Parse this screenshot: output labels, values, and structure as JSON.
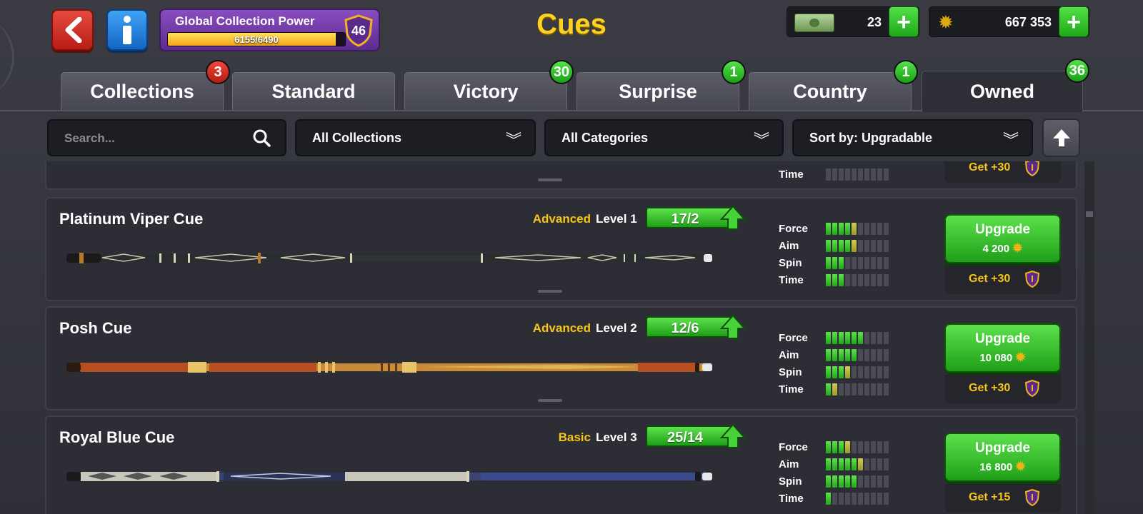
{
  "header": {
    "title": "Cues",
    "global_collection_power": {
      "label": "Global Collection Power",
      "current": 6155,
      "max": 6490,
      "text": "6155/6490",
      "level": "46"
    },
    "cash": {
      "amount": "23",
      "icon": "cash-icon"
    },
    "coins": {
      "amount": "667 353",
      "icon": "coin-gear-icon"
    }
  },
  "tabs": [
    {
      "label": "Collections",
      "badge": "3",
      "badge_color": "#d32a1f"
    },
    {
      "label": "Standard",
      "badge": null
    },
    {
      "label": "Victory",
      "badge": "30",
      "badge_color": "#2fbf22"
    },
    {
      "label": "Surprise",
      "badge": "1",
      "badge_color": "#2fbf22"
    },
    {
      "label": "Country",
      "badge": "1",
      "badge_color": "#2fbf22"
    },
    {
      "label": "Owned",
      "badge": "36",
      "badge_color": "#2fbf22",
      "active": true
    }
  ],
  "filters": {
    "search_placeholder": "Search...",
    "collections": "All Collections",
    "categories": "All Categories",
    "sort": "Sort by: Upgradable"
  },
  "partial_card": {
    "stat_label": "Time",
    "get_text": "Get +30"
  },
  "cues": [
    {
      "name": "Platinum Viper Cue",
      "tier": "Advanced",
      "level": "Level 1",
      "progress": "17/2",
      "stats": [
        {
          "label": "Force",
          "green": 4,
          "yellow": 1
        },
        {
          "label": "Aim",
          "green": 4,
          "yellow": 1
        },
        {
          "label": "Spin",
          "green": 3,
          "yellow": 0
        },
        {
          "label": "Time",
          "green": 3,
          "yellow": 0
        }
      ],
      "upgrade_label": "Upgrade",
      "upgrade_cost": "4 200",
      "get_text": "Get +30"
    },
    {
      "name": "Posh Cue",
      "tier": "Advanced",
      "level": "Level 2",
      "progress": "12/6",
      "stats": [
        {
          "label": "Force",
          "green": 6,
          "yellow": 0
        },
        {
          "label": "Aim",
          "green": 5,
          "yellow": 0
        },
        {
          "label": "Spin",
          "green": 3,
          "yellow": 1
        },
        {
          "label": "Time",
          "green": 1,
          "yellow": 1
        }
      ],
      "upgrade_label": "Upgrade",
      "upgrade_cost": "10 080",
      "get_text": "Get +30"
    },
    {
      "name": "Royal Blue Cue",
      "tier": "Basic",
      "level": "Level 3",
      "progress": "25/14",
      "stats": [
        {
          "label": "Force",
          "green": 3,
          "yellow": 1
        },
        {
          "label": "Aim",
          "green": 5,
          "yellow": 1
        },
        {
          "label": "Spin",
          "green": 5,
          "yellow": 0
        },
        {
          "label": "Time",
          "green": 1,
          "yellow": 0
        }
      ],
      "upgrade_label": "Upgrade",
      "upgrade_cost": "16 800",
      "get_text": "Get +15"
    }
  ],
  "colors": {
    "title_yellow": "#ffd21f",
    "tier_yellow": "#f6c518",
    "upgrade_green": "#2fbf22",
    "panel": "#2d2e35"
  }
}
